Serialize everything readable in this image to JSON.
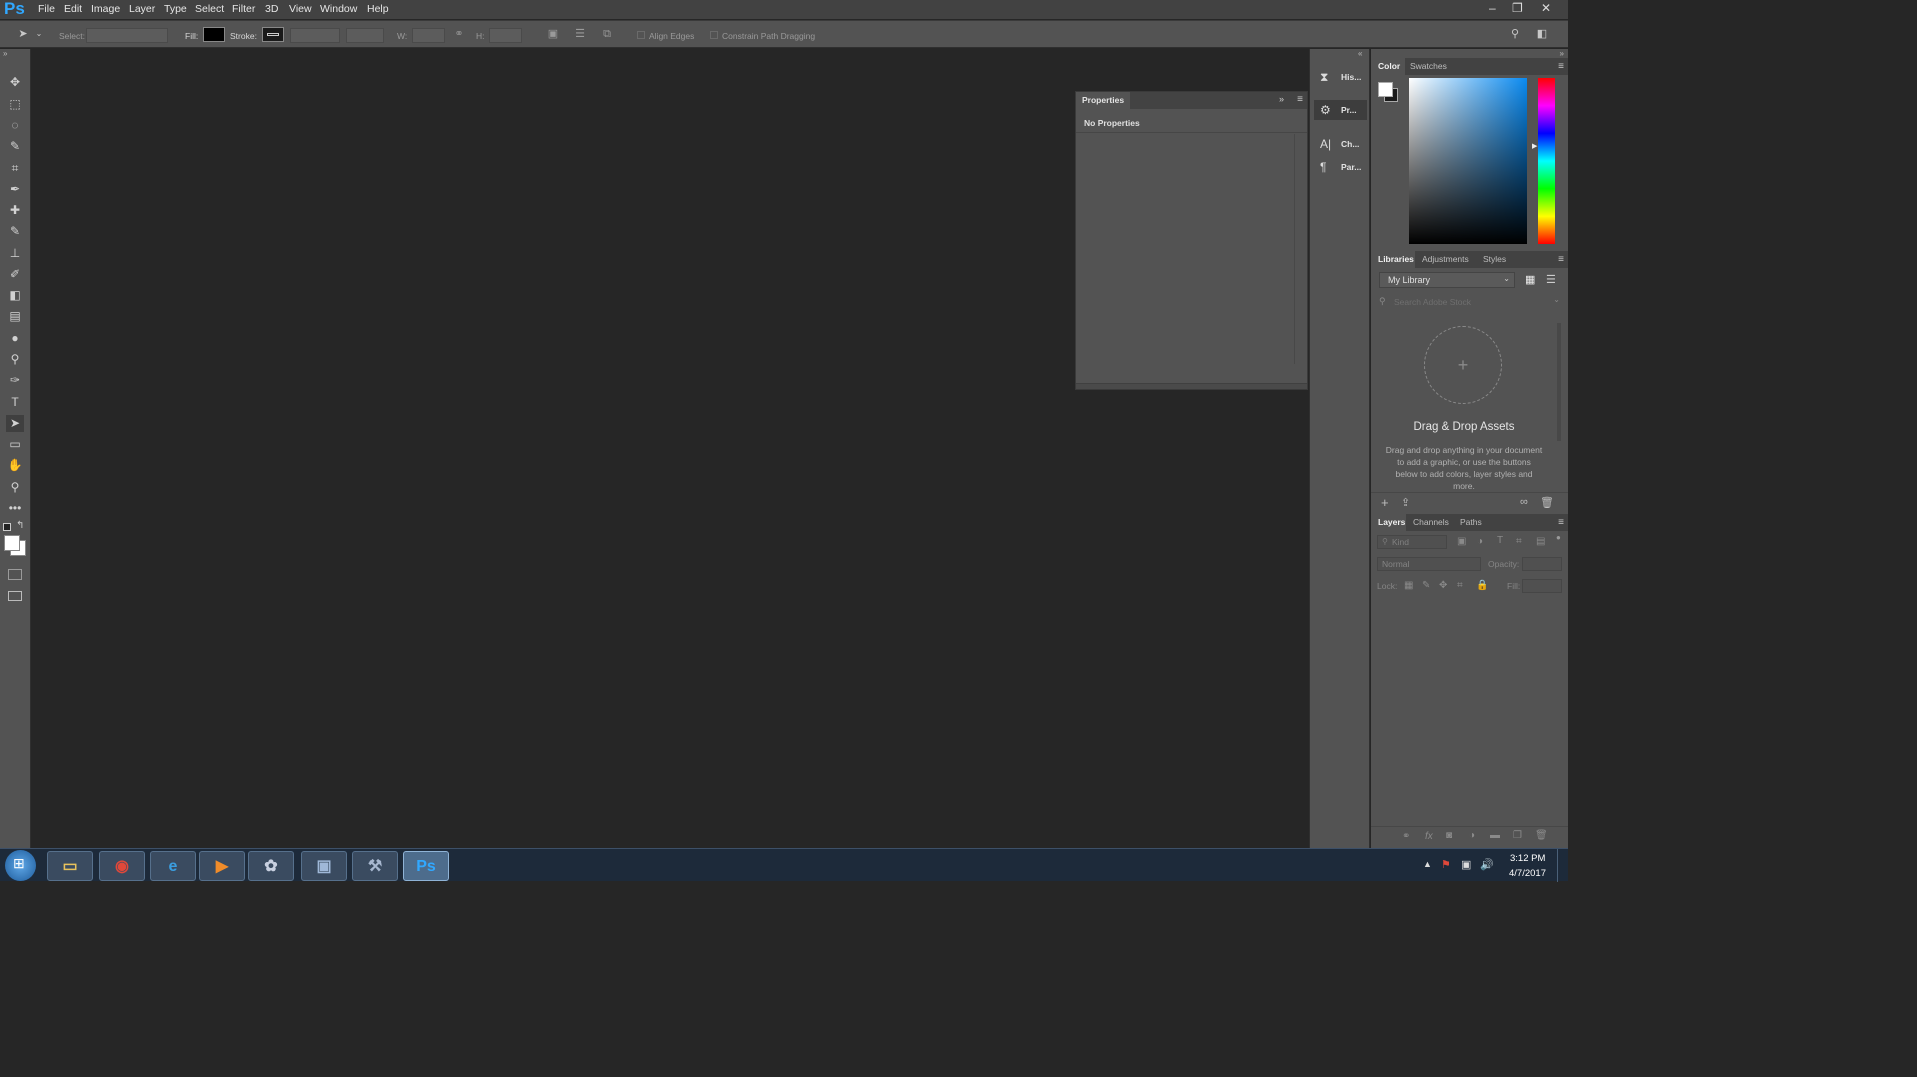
{
  "app": {
    "logo": "Ps",
    "accent": "#31a8ff"
  },
  "menu": [
    "File",
    "Edit",
    "Image",
    "Layer",
    "Type",
    "Select",
    "Filter",
    "3D",
    "View",
    "Window",
    "Help"
  ],
  "window_controls": {
    "minimize": "–",
    "restore": "❐",
    "close": "✕"
  },
  "options": {
    "select_label": "Select:",
    "fill_label": "Fill:",
    "fill_color": "#000000",
    "stroke_label": "Stroke:",
    "w_label": "W:",
    "h_label": "H:",
    "align_edges": "Align Edges",
    "constrain": "Constrain Path Dragging"
  },
  "tools": [
    {
      "name": "move-tool",
      "glyph": "✥"
    },
    {
      "name": "marquee-tool",
      "glyph": "⬚"
    },
    {
      "name": "lasso-tool",
      "glyph": "◌"
    },
    {
      "name": "quick-select-tool",
      "glyph": "✎"
    },
    {
      "name": "crop-tool",
      "glyph": "⌗"
    },
    {
      "name": "eyedropper-tool",
      "glyph": "✒"
    },
    {
      "name": "healing-brush-tool",
      "glyph": "✚"
    },
    {
      "name": "brush-tool",
      "glyph": "✎"
    },
    {
      "name": "clone-stamp-tool",
      "glyph": "⊥"
    },
    {
      "name": "history-brush-tool",
      "glyph": "✐"
    },
    {
      "name": "eraser-tool",
      "glyph": "◧"
    },
    {
      "name": "gradient-tool",
      "glyph": "▤"
    },
    {
      "name": "blur-tool",
      "glyph": "●"
    },
    {
      "name": "dodge-tool",
      "glyph": "⚲"
    },
    {
      "name": "pen-tool",
      "glyph": "✑"
    },
    {
      "name": "type-tool",
      "glyph": "T"
    },
    {
      "name": "path-selection-tool",
      "glyph": "➤"
    },
    {
      "name": "rectangle-tool",
      "glyph": "▭"
    },
    {
      "name": "hand-tool",
      "glyph": "✋"
    },
    {
      "name": "zoom-tool",
      "glyph": "⚲"
    },
    {
      "name": "more-tools",
      "glyph": "•••"
    }
  ],
  "properties": {
    "tab": "Properties",
    "empty": "No Properties"
  },
  "dock": [
    {
      "name": "history",
      "glyph": "⧗",
      "label": "His..."
    },
    {
      "name": "properties",
      "glyph": "⚙",
      "label": "Pr..."
    },
    {
      "name": "character",
      "glyph": "A|",
      "label": "Ch..."
    },
    {
      "name": "paragraph",
      "glyph": "¶",
      "label": "Par..."
    }
  ],
  "color_panel": {
    "tabs": [
      "Color",
      "Swatches"
    ]
  },
  "libraries": {
    "tabs": [
      "Libraries",
      "Adjustments",
      "Styles"
    ],
    "library": "My Library",
    "search_placeholder": "Search Adobe Stock",
    "title": "Drag & Drop Assets",
    "description": "Drag and drop anything in your document to add a graphic, or use the buttons below to add colors, layer styles and more."
  },
  "layers": {
    "tabs": [
      "Layers",
      "Channels",
      "Paths"
    ],
    "kind_placeholder": "Kind",
    "blend_mode": "Normal",
    "opacity_label": "Opacity:",
    "lock_label": "Lock:",
    "fill_label": "Fill:"
  },
  "taskbar": {
    "apps": [
      {
        "name": "explorer",
        "glyph": "▭",
        "color": "#e8c25c"
      },
      {
        "name": "chrome",
        "glyph": "◉",
        "color": "#e0483a"
      },
      {
        "name": "internet-explorer",
        "glyph": "e",
        "color": "#3a9ee0"
      },
      {
        "name": "media-player",
        "glyph": "▶",
        "color": "#f08c2a"
      },
      {
        "name": "paint",
        "glyph": "✿",
        "color": "#c8d0e0"
      },
      {
        "name": "photos",
        "glyph": "▣",
        "color": "#9fb8d8"
      },
      {
        "name": "tools",
        "glyph": "⚒",
        "color": "#a8b8d0"
      },
      {
        "name": "photoshop",
        "glyph": "Ps",
        "color": "#31a8ff"
      }
    ],
    "time": "3:12 PM",
    "date": "4/7/2017"
  }
}
